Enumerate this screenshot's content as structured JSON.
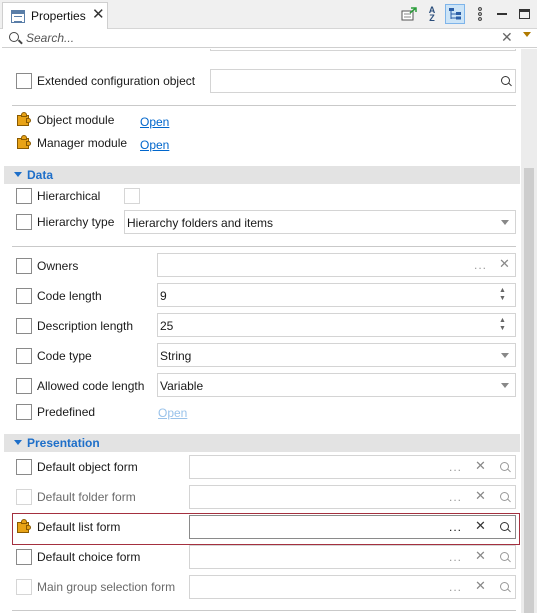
{
  "window": {
    "tab_title": "Properties",
    "toolbar_icons": [
      "note-icon",
      "sort-az-icon",
      "tree-view-icon",
      "view-menu-icon",
      "minimize-icon",
      "maximize-icon"
    ],
    "sort_top": "A",
    "sort_bottom": "Z"
  },
  "search": {
    "placeholder": "Search..."
  },
  "rows_top": [
    {
      "label": "Extended configuration object"
    }
  ],
  "modules": [
    {
      "label": "Object module",
      "link": "Open"
    },
    {
      "label": "Manager module",
      "link": "Open"
    }
  ],
  "sections": {
    "data": "Data",
    "presentation": "Presentation"
  },
  "data_rows": {
    "hierarchical": {
      "label": "Hierarchical"
    },
    "hierarchy_type": {
      "label": "Hierarchy type",
      "value": "Hierarchy folders and items"
    },
    "owners": {
      "label": "Owners",
      "ellipsis": "..."
    },
    "code_length": {
      "label": "Code length",
      "value": "9"
    },
    "description_length": {
      "label": "Description length",
      "value": "25"
    },
    "code_type": {
      "label": "Code type",
      "value": "String"
    },
    "allowed_code_length": {
      "label": "Allowed code length",
      "value": "Variable"
    },
    "predefined": {
      "label": "Predefined",
      "link": "Open"
    }
  },
  "presentation_rows": [
    {
      "label": "Default object form",
      "ellipsis": "..."
    },
    {
      "label": "Default folder form",
      "ellipsis": "..."
    },
    {
      "label": "Default list form",
      "ellipsis": "..."
    },
    {
      "label": "Default choice form",
      "ellipsis": "..."
    },
    {
      "label": "Main group selection form",
      "ellipsis": "..."
    }
  ],
  "colors": {
    "section_title": "#1e6fc9",
    "link": "#0066cc",
    "highlight_border": "#a4303f",
    "module_icon": "#e8a317"
  }
}
